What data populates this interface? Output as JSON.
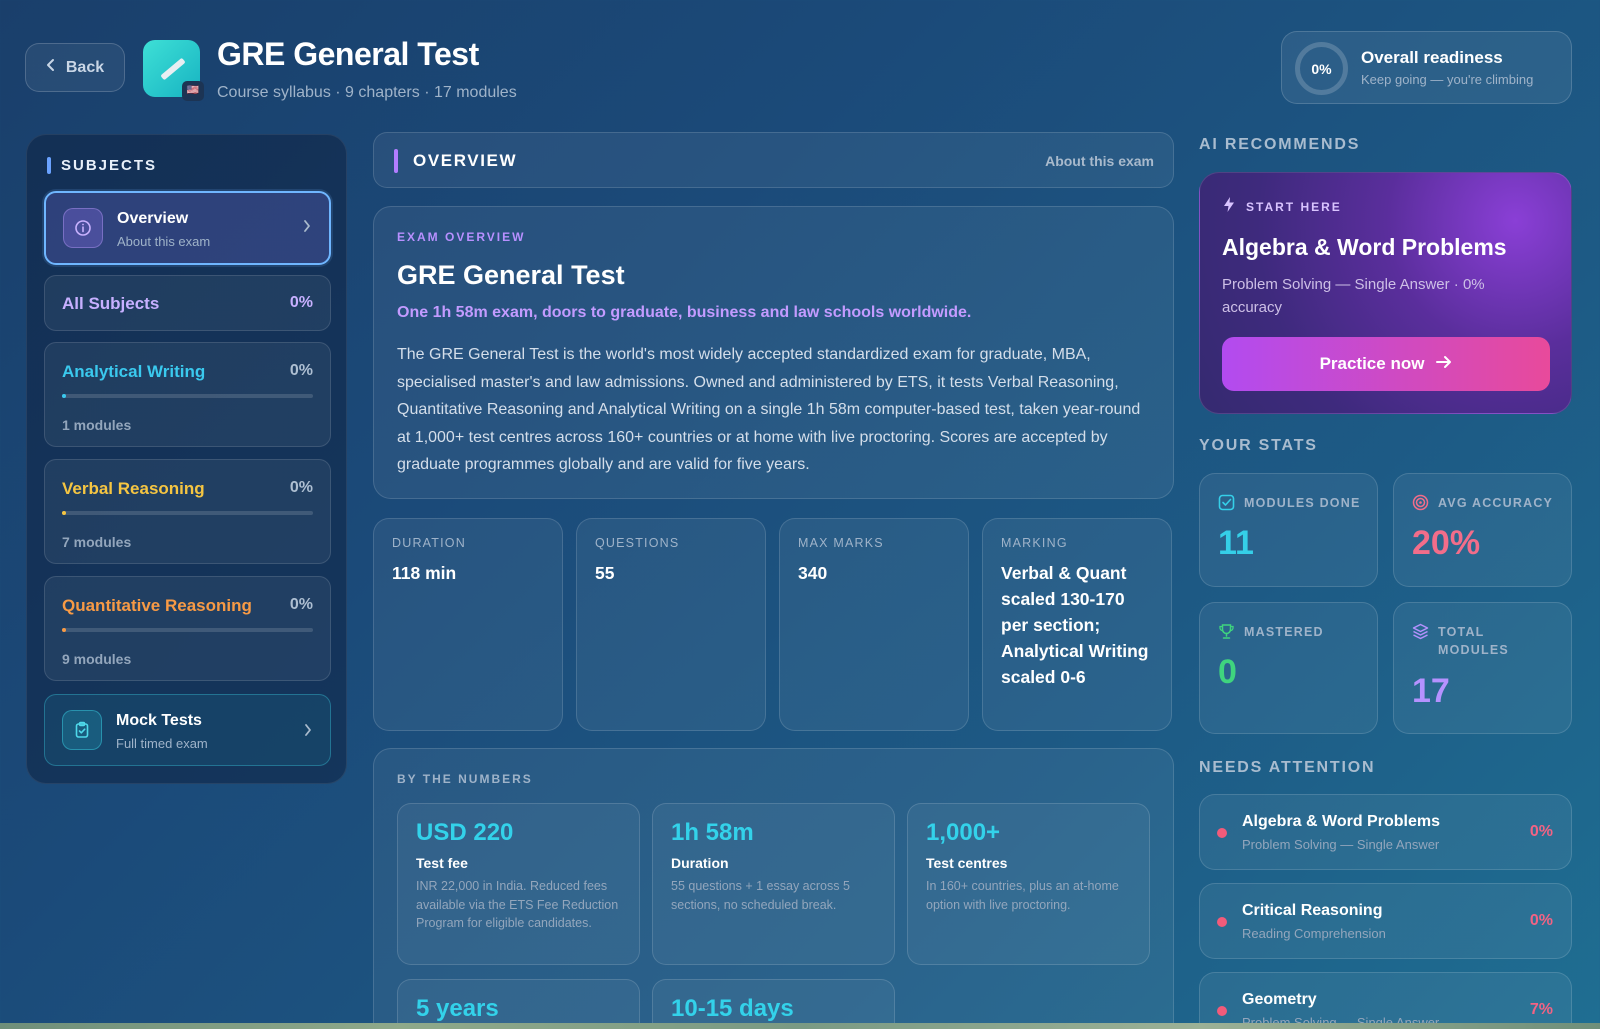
{
  "header": {
    "back_label": "Back",
    "title": "GRE General Test",
    "subtitle": "Course syllabus · 9 chapters · 17 modules",
    "flag": "🇺🇸",
    "readiness": {
      "value": "0%",
      "title": "Overall readiness",
      "subtitle": "Keep going — you're climbing"
    }
  },
  "sidebar": {
    "heading": "SUBJECTS",
    "overview": {
      "title": "Overview",
      "subtitle": "About this exam",
      "icon": "info-icon"
    },
    "all_subjects": {
      "label": "All Subjects",
      "pct": "0%"
    },
    "subjects": [
      {
        "name": "Analytical Writing",
        "pct": "0%",
        "modules": "1 modules",
        "progress": 0.01,
        "color": "#3ac9ee"
      },
      {
        "name": "Verbal Reasoning",
        "pct": "0%",
        "modules": "7 modules",
        "progress": 0.01,
        "color": "#f5c542"
      },
      {
        "name": "Quantitative Reasoning",
        "pct": "0%",
        "modules": "9 modules",
        "progress": 0.01,
        "color": "#f79a45"
      }
    ],
    "mock": {
      "title": "Mock Tests",
      "subtitle": "Full timed exam",
      "icon": "clipboard-icon"
    }
  },
  "overview_bar": {
    "title": "OVERVIEW",
    "meta": "About this exam"
  },
  "exam": {
    "eyebrow": "EXAM OVERVIEW",
    "title": "GRE General Test",
    "tagline": "One 1h 58m exam, doors to graduate, business and law schools worldwide.",
    "description": "The GRE General Test is the world's most widely accepted standardized exam for graduate, MBA, specialised master's and law admissions. Owned and administered by ETS, it tests Verbal Reasoning, Quantitative Reasoning and Analytical Writing on a single 1h 58m computer-based test, taken year-round at 1,000+ test centres across 160+ countries or at home with live proctoring. Scores are accepted by graduate programmes globally and are valid for five years."
  },
  "stats": [
    {
      "label": "DURATION",
      "value": "118 min"
    },
    {
      "label": "QUESTIONS",
      "value": "55"
    },
    {
      "label": "MAX MARKS",
      "value": "340"
    },
    {
      "label": "MARKING",
      "value": "Verbal & Quant scaled 130-170 per section; Analytical Writing scaled 0-6"
    }
  ],
  "numbers": {
    "heading": "BY THE NUMBERS",
    "cards": [
      {
        "big": "USD 220",
        "label": "Test fee",
        "desc": "INR 22,000 in India. Reduced fees available via the ETS Fee Reduction Program for eligible candidates."
      },
      {
        "big": "1h 58m",
        "label": "Duration",
        "desc": "55 questions + 1 essay across 5 sections, no scheduled break."
      },
      {
        "big": "1,000+",
        "label": "Test centres",
        "desc": "In 160+ countries, plus an at-home option with live proctoring."
      },
      {
        "big": "5 years",
        "label": "",
        "desc": ""
      },
      {
        "big": "10-15 days",
        "label": "",
        "desc": ""
      }
    ]
  },
  "recommend": {
    "section": "AI RECOMMENDS",
    "eyebrow": "START HERE",
    "title": "Algebra & Word Problems",
    "subtitle": "Problem Solving — Single Answer · 0% accuracy",
    "button": "Practice now"
  },
  "your_stats": {
    "section": "YOUR STATS",
    "items": [
      {
        "label": "MODULES DONE",
        "value": "11",
        "color": "#35cfe8",
        "icon": "check-square-icon"
      },
      {
        "label": "AVG ACCURACY",
        "value": "20%",
        "color": "#f26d8a",
        "icon": "target-icon"
      },
      {
        "label": "MASTERED",
        "value": "0",
        "color": "#3fd47e",
        "icon": "trophy-icon"
      },
      {
        "label": "TOTAL MODULES",
        "value": "17",
        "color": "#b592ff",
        "icon": "layers-icon"
      }
    ]
  },
  "attention": {
    "section": "NEEDS ATTENTION",
    "items": [
      {
        "title": "Algebra & Word Problems",
        "subtitle": "Problem Solving — Single Answer",
        "pct": "0%"
      },
      {
        "title": "Critical Reasoning",
        "subtitle": "Reading Comprehension",
        "pct": "0%"
      },
      {
        "title": "Geometry",
        "subtitle": "Problem Solving — Single Answer",
        "pct": "7%"
      }
    ]
  }
}
